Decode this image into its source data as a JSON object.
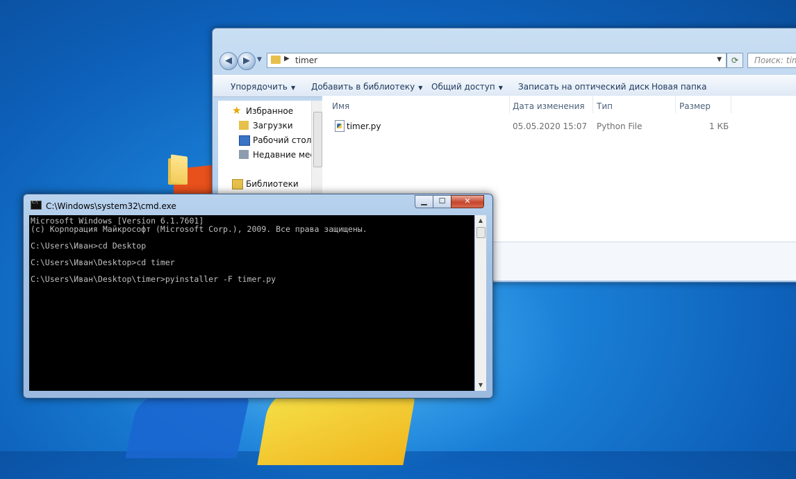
{
  "desktop": {
    "icon_name": "folder-icon"
  },
  "explorer": {
    "address_path": "timer",
    "search_placeholder": "Поиск: timer",
    "toolbar": {
      "organize": "Упорядочить",
      "add_to_library": "Добавить в библиотеку",
      "share": "Общий доступ",
      "burn": "Записать на оптический диск",
      "new_folder": "Новая папка"
    },
    "nav_pane": {
      "favorites": "Избранное",
      "downloads": "Загрузки",
      "desktop": "Рабочий стол",
      "recent": "Недавние мес",
      "libraries": "Библиотеки"
    },
    "columns": {
      "name": "Имя",
      "date": "Дата изменения",
      "type": "Тип",
      "size": "Размер"
    },
    "files": [
      {
        "name": "timer.py",
        "date": "05.05.2020 15:07",
        "type": "Python File",
        "size": "1 КБ"
      }
    ]
  },
  "cmd": {
    "title": "C:\\Windows\\system32\\cmd.exe",
    "output": "Microsoft Windows [Version 6.1.7601]\n(c) Корпорация Майкрософт (Microsoft Corp.), 2009. Все права защищены.\n\nC:\\Users\\Иван>cd Desktop\n\nC:\\Users\\Иван\\Desktop>cd timer\n\nC:\\Users\\Иван\\Desktop\\timer>pyinstaller -F timer.py"
  }
}
